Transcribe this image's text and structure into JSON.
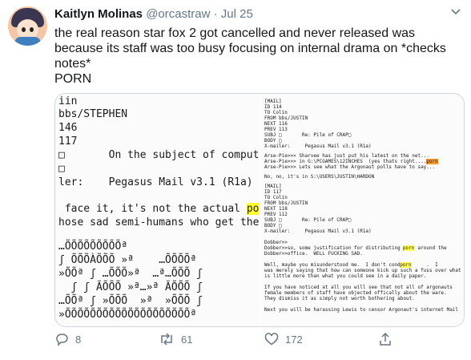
{
  "tweet": {
    "author_name": "Kaitlyn Molinas",
    "handle": "@orcastraw",
    "separator": "·",
    "date": "Jul 25",
    "text_lines": [
      "the real reason star fox 2 got cancelled and never released was",
      "because its staff was too busy focusing on internal drama on *checks",
      "notes*",
      "PORN"
    ],
    "left_screenshot_lines": [
      "iin",
      "bbs/STEPHEN",
      "146",
      "117",
      "□       On the subject of compute",
      "□",
      "ler:    Pegasus Mail v3.1 (R1a)",
      " face it, it's not the actual ",
      "hose sad semi-humans who get the",
      "…ÕÕÕÕÕÕÕÕÕª",
      "ʃ ÕÕÕÀÕÕÕ »ª    …ÕÕÕÕª",
      "»ÕÕª ʃ …ÕÕÕ»ª  …ª…ÕÕÕ ʃ",
      "  ʃ ʃ ÃÕÕÕ »ª…»ª ÃÕÕÕ ʃ",
      "…ÕÕª ʃ »ÕÕÕ  »ª  »ÕÕÕ ʃ",
      "»ÕÕÕÕÕÕÕÕÕÕÕÕÕÕÕÕÕÕÕÕª"
    ],
    "left_highlight": "po",
    "right_screenshot_lines": [
      "[MAIL]",
      "ID 114",
      "TO Colin",
      "FROM bbs/JUSTIN",
      "NEXT 116",
      "PREV 113",
      "SUBJ □       Re: Pile of CRAP□",
      "BODY □",
      "X-mailer:     Pegasus Mail v3.1 (R1a)",
      "",
      "Arse-Pie>>> Sharvee has just put his latest on the net...",
      "Arse-Pie>>> in G:\\PCGAMES\\12INCHES  (yes thats right....",
      "Arse-Pie>>> Lets see what the Argonaut polls have to say...",
      "",
      "No, no, it's in S:\\USERS\\JUSTIN\\HARDON",
      "",
      "[MAIL]",
      "ID 117",
      "TO Colin",
      "FROM bbs/JUSTIN",
      "NEXT 118",
      "PREV 112",
      "SUBJ □       Re: Pile of CRAP□",
      "BODY □",
      "X-mailer:     Pegasus Mail v3.1 (R1a)",
      "",
      "Dobber>>",
      "Dobber>>so, some justification for distributing      around the",
      "Dobber>>office.  WELL FUCKING SAD.",
      "",
      "Well, maybe you misunderstood me.  I don't condone      .  I",
      "was merely saying that how can someone kick up such a fuss over what",
      "is little more than what you could see in a daily paper.",
      "",
      "If you have noticed at all you will see that not all of argonauts",
      "female members of staff have objected offically about the ware.",
      "They dismiss it as simply not worth bothering about.",
      "",
      "Next you will be harassing Lewis to censor Argonaut's internet Mail"
    ],
    "right_highlight": "porn",
    "stats": {
      "replies": "8",
      "retweets": "61",
      "likes": "172"
    },
    "colors": {
      "name": "#14171a",
      "meta": "#657786",
      "highlight_yellow": "#ffff33",
      "highlight_orange": "#ff9a2e"
    },
    "icons": [
      "avatar",
      "chevron-down-icon",
      "reply-icon",
      "retweet-icon",
      "like-icon",
      "share-icon"
    ]
  }
}
